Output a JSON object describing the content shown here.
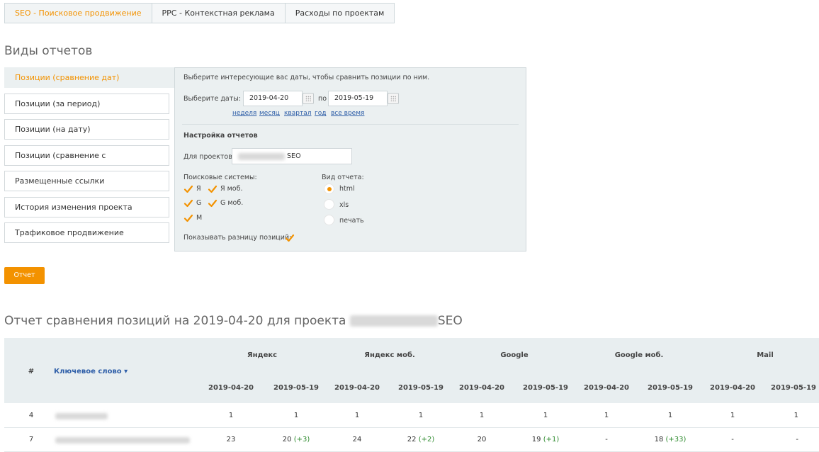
{
  "top_tabs": [
    {
      "label": "SEO - Поисковое продвижение",
      "active": true
    },
    {
      "label": "PPC - Контекстная реклама",
      "active": false
    },
    {
      "label": "Расходы по проектам",
      "active": false
    }
  ],
  "section_title": "Виды отчетов",
  "report_types": [
    {
      "label": "Позиции (сравнение дат)",
      "active": true
    },
    {
      "label": "Позиции (за период)",
      "active": false
    },
    {
      "label": "Позиции (на дату)",
      "active": false
    },
    {
      "label": "Позиции (сравнение с конкурентами)",
      "active": false
    },
    {
      "label": "Размещенные ссылки",
      "active": false
    },
    {
      "label": "История изменения проекта",
      "active": false
    },
    {
      "label": "Трафиковое продвижение",
      "active": false
    }
  ],
  "panel": {
    "hint": "Выберите интересующие вас даты, чтобы сравнить позиции по ним.",
    "date_label": "Выберите даты: с",
    "date_from": "2019-04-20",
    "date_to_label": "по",
    "date_to": "2019-05-19",
    "period_links": [
      "неделя",
      "месяц",
      "квартал",
      "год",
      "все время"
    ],
    "settings_title": "Настройка отчетов",
    "projects_label": "Для проектов:",
    "project_value_suffix": "SEO",
    "search_engines_label": "Поисковые системы:",
    "search_engines": [
      {
        "label": "Я",
        "checked": true
      },
      {
        "label": "Я моб.",
        "checked": true
      },
      {
        "label": "G",
        "checked": true
      },
      {
        "label": "G моб.",
        "checked": true
      },
      {
        "label": "M",
        "checked": true
      }
    ],
    "report_view_label": "Вид отчета:",
    "report_views": [
      {
        "label": "html",
        "selected": true
      },
      {
        "label": "xls",
        "selected": false
      },
      {
        "label": "печать",
        "selected": false
      }
    ],
    "show_diff_label": "Показывать разницу позиций:",
    "show_diff_checked": true
  },
  "report_button": "Отчет",
  "results": {
    "title_prefix": "Отчет сравнения позиций на 2019-04-20 для проекта",
    "title_suffix": "SEO",
    "col_num": "#",
    "col_keyword": "Ключевое слово ▾",
    "engines": [
      "Яндекс",
      "Яндекс моб.",
      "Google",
      "Google моб.",
      "Mail"
    ],
    "date1": "2019-04-20",
    "date2": "2019-05-19",
    "rows": [
      {
        "num": "4",
        "cells": [
          {
            "v": "1",
            "d": ""
          },
          {
            "v": "1",
            "d": ""
          },
          {
            "v": "1",
            "d": ""
          },
          {
            "v": "1",
            "d": ""
          },
          {
            "v": "1",
            "d": ""
          },
          {
            "v": "1",
            "d": ""
          },
          {
            "v": "1",
            "d": ""
          },
          {
            "v": "1",
            "d": ""
          },
          {
            "v": "1",
            "d": ""
          },
          {
            "v": "1",
            "d": ""
          }
        ]
      },
      {
        "num": "7",
        "cells": [
          {
            "v": "23",
            "d": ""
          },
          {
            "v": "20",
            "d": "(+3)"
          },
          {
            "v": "24",
            "d": ""
          },
          {
            "v": "22",
            "d": "(+2)"
          },
          {
            "v": "20",
            "d": ""
          },
          {
            "v": "19",
            "d": "(+1)"
          },
          {
            "v": "-",
            "d": ""
          },
          {
            "v": "18",
            "d": "(+33)"
          },
          {
            "v": "-",
            "d": ""
          },
          {
            "v": "-",
            "d": ""
          }
        ]
      }
    ]
  }
}
